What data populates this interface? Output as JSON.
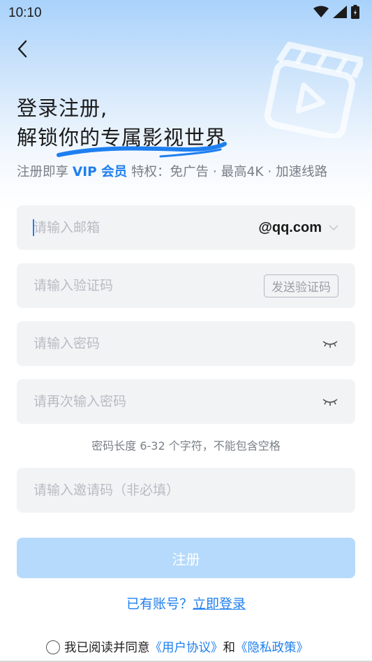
{
  "status_bar": {
    "time": "10:10",
    "icons": [
      "wifi-icon",
      "signal-icon",
      "battery-icon"
    ]
  },
  "header": {
    "back_icon": "back-arrow-icon",
    "headline_line1": "登录注册,",
    "headline_line2": "解锁你的专属影视世界",
    "benefits_prefix": "注册即享",
    "benefits_vip": "VIP 会员",
    "benefits_suffix": "特权：免广告 · 最高4K · 加速线路"
  },
  "form": {
    "email": {
      "placeholder": "请输入邮箱",
      "value": "",
      "domain": "@qq.com"
    },
    "code": {
      "placeholder": "请输入验证码",
      "value": "",
      "send_label": "发送验证码"
    },
    "password": {
      "placeholder": "请输入密码",
      "value": ""
    },
    "password_confirm": {
      "placeholder": "请再次输入密码",
      "value": ""
    },
    "password_hint": "密码长度 6-32 个字符，不能包含空格",
    "invite": {
      "placeholder": "请输入邀请码（非必填）",
      "value": ""
    },
    "submit_label": "注册"
  },
  "login": {
    "prompt": "已有账号？",
    "link": "立即登录"
  },
  "agreement": {
    "checked": false,
    "text": "我已阅读并同意",
    "user_agreement": "《用户协议》",
    "and": "和",
    "privacy_policy": "《隐私政策》"
  },
  "colors": {
    "accent": "#1e7ff0",
    "button_disabled": "#b6dafb",
    "field_bg": "#f2f3f5"
  }
}
